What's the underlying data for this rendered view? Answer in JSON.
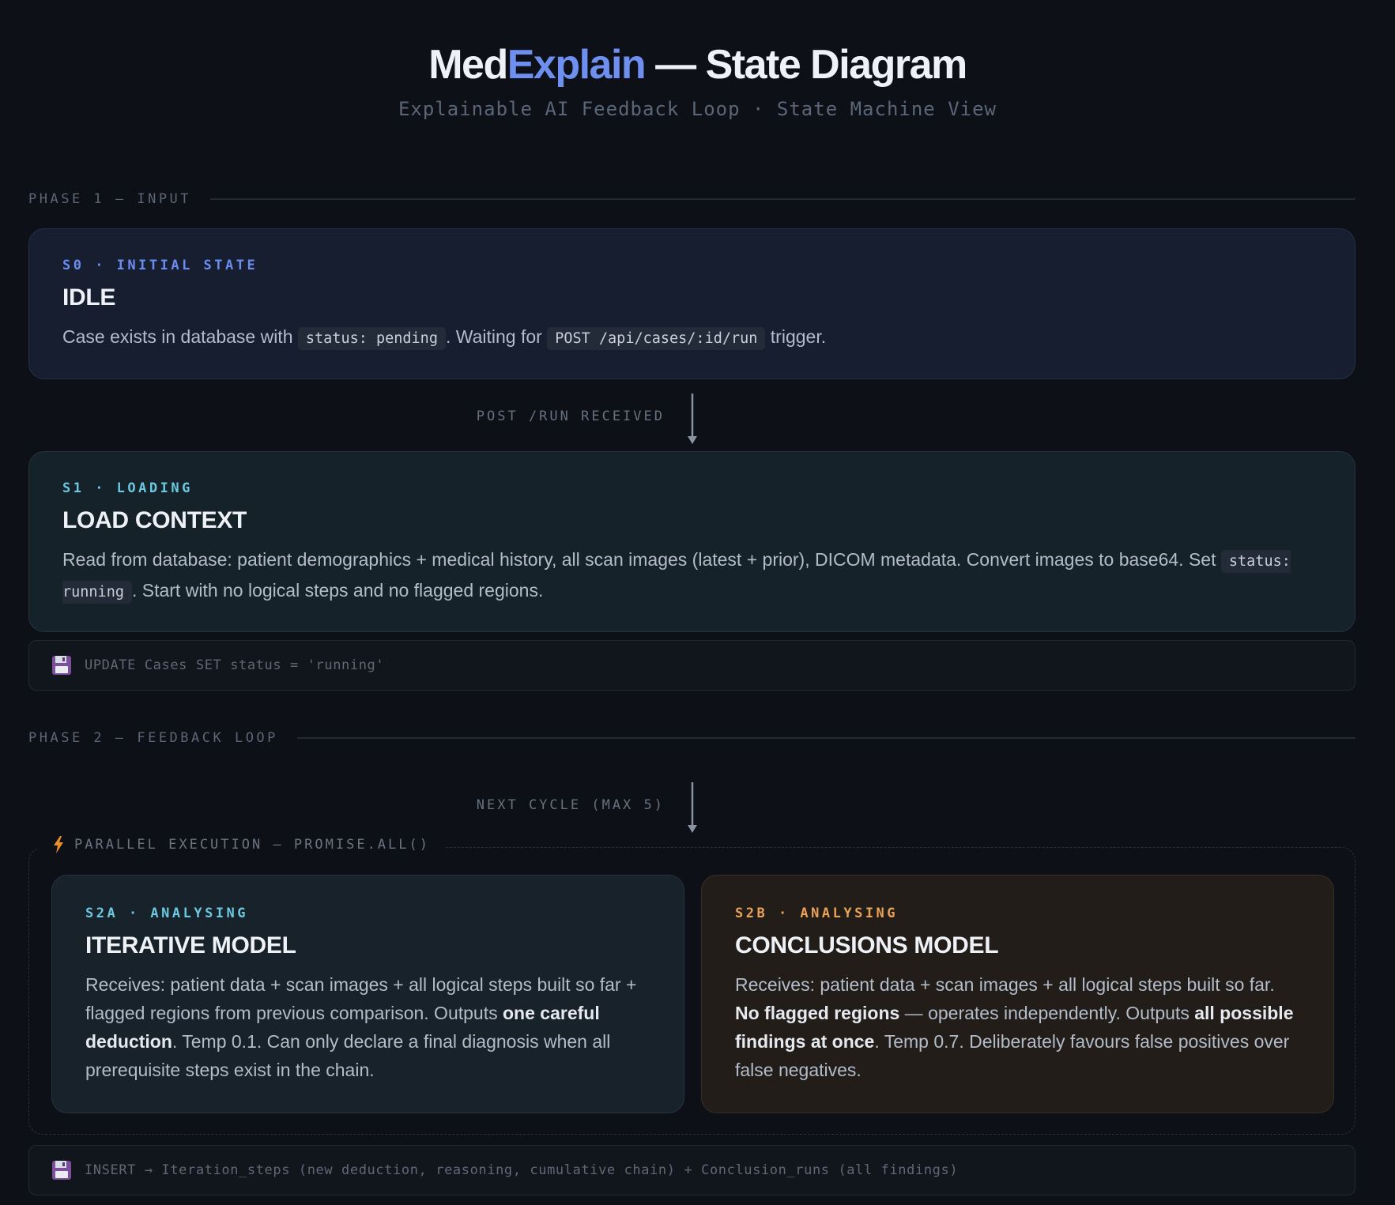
{
  "header": {
    "title_part1": "Med",
    "title_accent": "Explain",
    "title_part2": " — State Diagram",
    "subtitle": "Explainable AI Feedback Loop · State Machine View"
  },
  "phases": [
    {
      "label": "PHASE 1 — INPUT"
    },
    {
      "label": "PHASE 2 — FEEDBACK LOOP"
    }
  ],
  "states": {
    "s0": {
      "tag": "S0 · INITIAL STATE",
      "title": "IDLE",
      "desc_1": "Case exists in database with ",
      "code_1": "status: pending",
      "desc_2": ". Waiting for ",
      "code_2": "POST /api/cases/:id/run",
      "desc_3": " trigger."
    },
    "s1": {
      "tag": "S1 · LOADING",
      "title": "LOAD CONTEXT",
      "desc_1": "Read from database: patient demographics + medical history, all scan images (latest + prior), DICOM metadata. Convert images to base64. Set ",
      "code_1": "status: running",
      "desc_2": ". Start with no logical steps and no flagged regions."
    },
    "s2a": {
      "tag": "S2A · ANALYSING",
      "title": "ITERATIVE MODEL",
      "desc_1": "Receives: patient data + scan images + all logical steps built so far + flagged regions from previous comparison. Outputs ",
      "bold_1": "one careful deduction",
      "desc_2": ". Temp 0.1. Can only declare a final diagnosis when all prerequisite steps exist in the chain."
    },
    "s2b": {
      "tag": "S2B · ANALYSING",
      "title": "CONCLUSIONS MODEL",
      "desc_1": "Receives: patient data + scan images + all logical steps built so far. ",
      "bold_1": "No flagged regions",
      "desc_2": " — operates independently. Outputs ",
      "bold_2": "all possible findings at once",
      "desc_3": ". Temp 0.7. Deliberately favours false positives over false negatives."
    }
  },
  "transitions": [
    {
      "label": "POST /RUN RECEIVED"
    },
    {
      "label": "NEXT CYCLE (MAX 5)"
    }
  ],
  "db_notes": [
    {
      "icon": "floppy-disk-icon",
      "text": "UPDATE Cases SET status = 'running'"
    },
    {
      "icon": "floppy-disk-icon",
      "text": "INSERT → Iteration_steps (new deduction, reasoning, cumulative chain) + Conclusion_runs (all findings)"
    }
  ],
  "parallel": {
    "icon": "lightning-icon",
    "label": "PARALLEL EXECUTION — PROMISE.ALL()"
  },
  "colors": {
    "background": "#0d1016",
    "accent_blue": "#6e8ff0",
    "accent_cyan": "#6cc8e0",
    "accent_orange": "#e9a256"
  }
}
